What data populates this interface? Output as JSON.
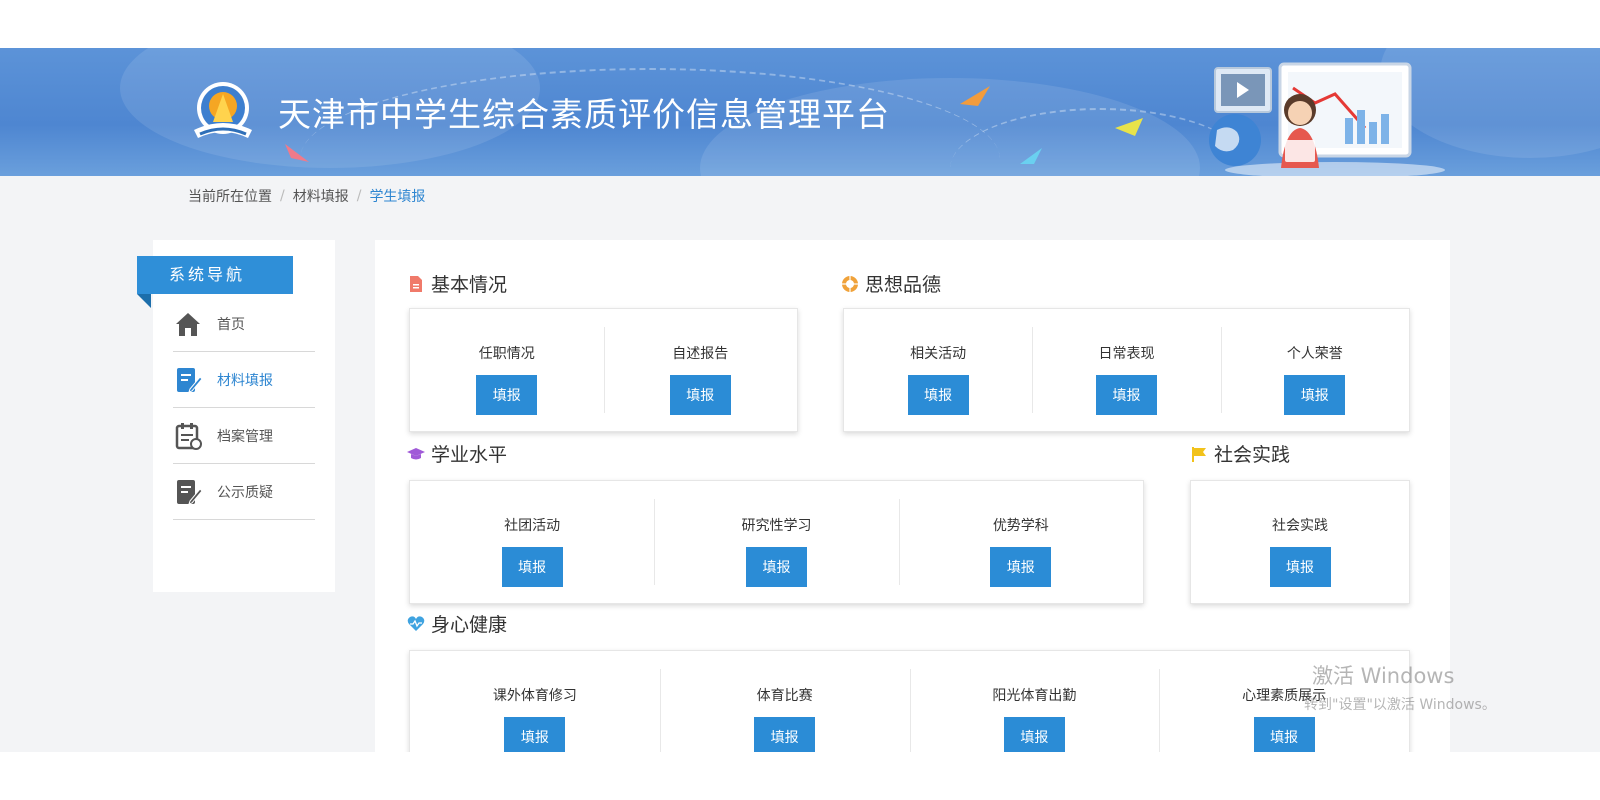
{
  "header": {
    "title": "天津市中学生综合素质评价信息管理平台"
  },
  "breadcrumb": {
    "items": [
      "当前所在位置",
      "材料填报",
      "学生填报"
    ],
    "separator": "/"
  },
  "sidebar": {
    "title": "系统导航",
    "items": [
      {
        "label": "首页",
        "icon": "home-icon"
      },
      {
        "label": "材料填报",
        "icon": "edit-document-icon"
      },
      {
        "label": "档案管理",
        "icon": "archive-icon"
      },
      {
        "label": "公示质疑",
        "icon": "publicity-icon"
      }
    ],
    "active_index": 1
  },
  "main": {
    "button_label": "填报",
    "sections": {
      "basic": {
        "title": "基本情况",
        "icon": "document-icon",
        "icon_color": "#f07a6a",
        "items": [
          "任职情况",
          "自述报告"
        ]
      },
      "moral": {
        "title": "思想品德",
        "icon": "lifebuoy-icon",
        "icon_color": "#f0a23a",
        "items": [
          "相关活动",
          "日常表现",
          "个人荣誉"
        ]
      },
      "academic": {
        "title": "学业水平",
        "icon": "graduation-cap-icon",
        "icon_color": "#a05ad8",
        "items": [
          "社团活动",
          "研究性学习",
          "优势学科"
        ]
      },
      "social": {
        "title": "社会实践",
        "icon": "flag-icon",
        "icon_color": "#f2c21a",
        "items": [
          "社会实践"
        ]
      },
      "health": {
        "title": "身心健康",
        "icon": "heart-pulse-icon",
        "icon_color": "#3fa3e0",
        "items": [
          "课外体育修习",
          "体育比赛",
          "阳光体育出勤",
          "心理素质展示"
        ]
      }
    }
  },
  "watermark": {
    "line1": "激活 Windows",
    "line2": "转到\"设置\"以激活 Windows。"
  },
  "colors": {
    "primary": "#2b8cd6",
    "banner": "#4e86d1",
    "background": "#f3f4f6"
  }
}
